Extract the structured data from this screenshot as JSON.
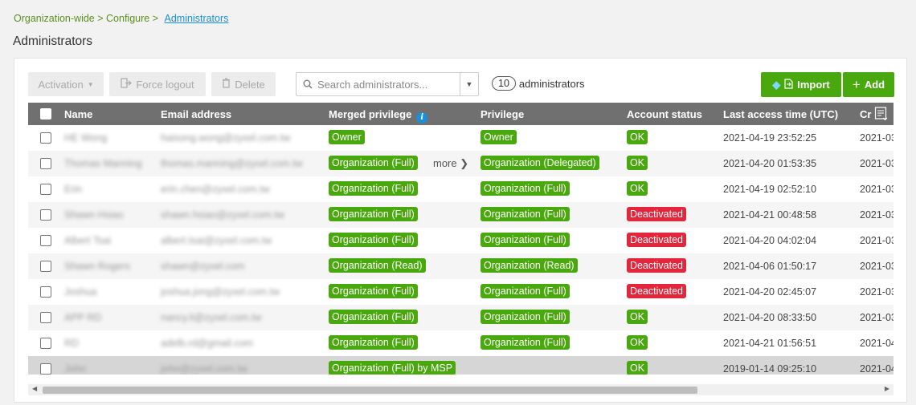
{
  "breadcrumb": {
    "item1": "Organization-wide",
    "item2": "Configure",
    "current": "Administrators",
    "sep": ">"
  },
  "page_title": "Administrators",
  "toolbar": {
    "activation": "Activation",
    "force_logout": "Force logout",
    "delete": "Delete",
    "search_placeholder": "Search administrators...",
    "count": "10",
    "count_label": "administrators",
    "import": "Import",
    "add": "Add"
  },
  "columns": {
    "name": "Name",
    "email": "Email address",
    "merged": "Merged privilege",
    "privilege": "Privilege",
    "status": "Account status",
    "last_access": "Last access time (UTC)",
    "created": "Cr"
  },
  "rows": [
    {
      "name": "HE Wong",
      "email": "haisong.wong@zyxel.com.tw",
      "merged": "Owner",
      "merged_more": "",
      "privilege": "Owner",
      "status": "OK",
      "last": "2021-04-19 23:52:25",
      "created": "2021-03"
    },
    {
      "name": "Thomas Manning",
      "email": "thomas.manning@zyxel.com.tw",
      "merged": "Organization (Full)",
      "merged_more": "more",
      "privilege": "Organization (Delegated)",
      "status": "OK",
      "last": "2021-04-20 01:53:35",
      "created": "2021-03"
    },
    {
      "name": "Erin",
      "email": "erin.chen@zyxel.com.tw",
      "merged": "Organization (Full)",
      "merged_more": "",
      "privilege": "Organization (Full)",
      "status": "OK",
      "last": "2021-04-19 02:52:10",
      "created": "2021-03"
    },
    {
      "name": "Shawn Hsiao",
      "email": "shawn.hsiao@zyxel.com.tw",
      "merged": "Organization (Full)",
      "merged_more": "",
      "privilege": "Organization (Full)",
      "status": "Deactivated",
      "last": "2021-04-21 00:48:58",
      "created": "2021-03"
    },
    {
      "name": "Albert Tsai",
      "email": "albert.tsai@zyxel.com.tw",
      "merged": "Organization (Full)",
      "merged_more": "",
      "privilege": "Organization (Full)",
      "status": "Deactivated",
      "last": "2021-04-20 04:02:04",
      "created": "2021-03"
    },
    {
      "name": "Shawn Rogers",
      "email": "shawn@zyxel.com",
      "merged": "Organization (Read)",
      "merged_more": "",
      "privilege": "Organization (Read)",
      "status": "Deactivated",
      "last": "2021-04-06 01:50:17",
      "created": "2021-03"
    },
    {
      "name": "Joshua",
      "email": "joshua.jong@zyxel.com.tw",
      "merged": "Organization (Full)",
      "merged_more": "",
      "privilege": "Organization (Full)",
      "status": "Deactivated",
      "last": "2021-04-20 02:45:07",
      "created": "2021-03"
    },
    {
      "name": "APP RD",
      "email": "nancy.li@zyxel.com.tw",
      "merged": "Organization (Full)",
      "merged_more": "",
      "privilege": "Organization (Full)",
      "status": "OK",
      "last": "2021-04-20 08:33:50",
      "created": "2021-03"
    },
    {
      "name": "RD",
      "email": "adelb.rd@gmail.com",
      "merged": "Organization (Full)",
      "merged_more": "",
      "privilege": "Organization (Full)",
      "status": "OK",
      "last": "2021-04-21 01:56:51",
      "created": "2021-04"
    },
    {
      "name": "John",
      "email": "john@zyxel.com.tw",
      "merged": "Organization (Full) by MSP",
      "merged_more": "",
      "privilege": "",
      "status": "OK",
      "last": "2019-01-14 09:25:10",
      "created": "2021-04"
    }
  ],
  "colors": {
    "green": "#4aa80f",
    "red": "#e3263c",
    "header": "#707070",
    "link": "#1a8fd6"
  }
}
